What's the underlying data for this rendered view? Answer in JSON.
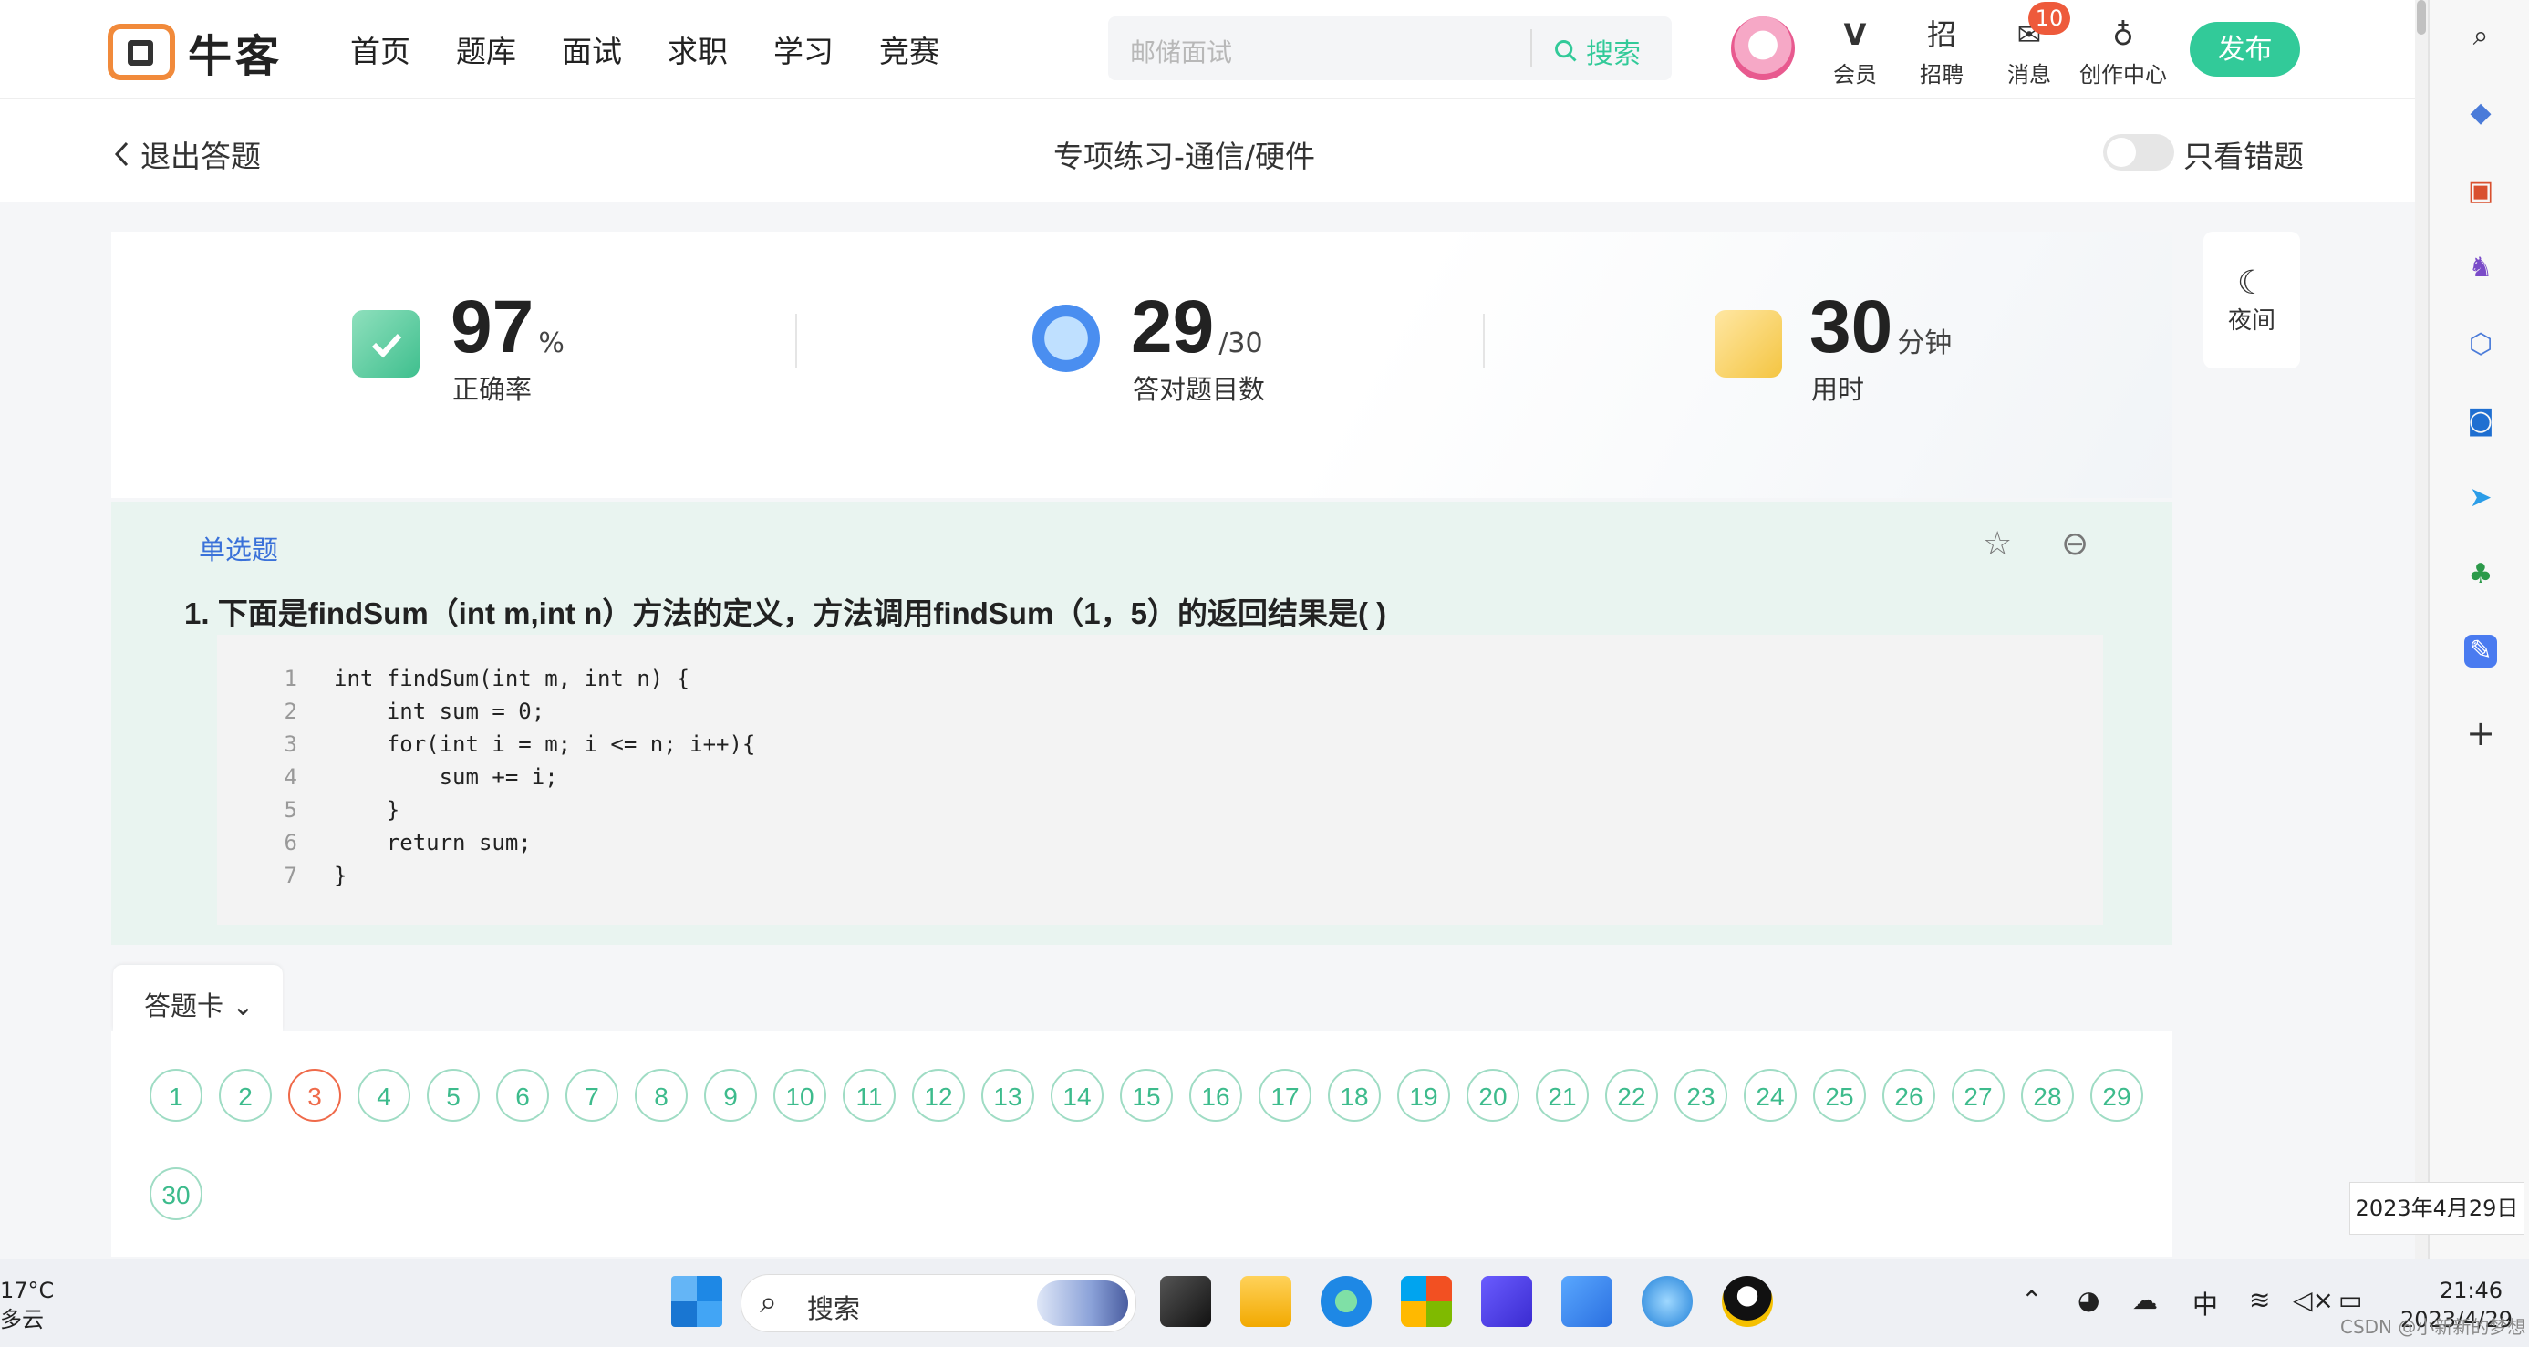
{
  "header": {
    "logo_text": "牛客",
    "nav": [
      "首页",
      "题库",
      "面试",
      "求职",
      "学习",
      "竞赛"
    ],
    "search_placeholder": "邮储面试",
    "search_button": "搜索",
    "icons": [
      {
        "label": "会员",
        "icon": "vip-icon",
        "glyph": "V"
      },
      {
        "label": "招聘",
        "icon": "recruit-icon",
        "glyph": "招"
      },
      {
        "label": "消息",
        "icon": "message-icon",
        "glyph": "✉"
      },
      {
        "label": "创作中心",
        "icon": "bulb-icon",
        "glyph": "♁"
      }
    ],
    "message_badge": "10",
    "publish_button": "发布"
  },
  "subheader": {
    "exit_label": "退出答题",
    "title": "专项练习-通信/硬件",
    "only_wrong_label": "只看错题"
  },
  "stats": {
    "accuracy": {
      "value": "97",
      "unit": "%",
      "label": "正确率"
    },
    "correct": {
      "value": "29",
      "unit": "/30",
      "label": "答对题目数"
    },
    "time": {
      "value": "30",
      "unit": "分钟",
      "label": "用时"
    },
    "night_label": "夜间"
  },
  "question": {
    "type": "单选题",
    "number": "1.",
    "text": "下面是findSum（int m,int n）方法的定义，方法调用findSum（1，5）的返回结果是( )",
    "code_lines": [
      {
        "n": "1",
        "code": "int findSum(int m, int n) {"
      },
      {
        "n": "2",
        "code": "    int sum = 0;"
      },
      {
        "n": "3",
        "code": "    for(int i = m; i <= n; i++){"
      },
      {
        "n": "4",
        "code": "        sum += i;"
      },
      {
        "n": "5",
        "code": "    }"
      },
      {
        "n": "6",
        "code": "    return sum;"
      },
      {
        "n": "7",
        "code": "}"
      }
    ]
  },
  "answer_card": {
    "tab_label": "答题卡",
    "numbers": [
      "1",
      "2",
      "3",
      "4",
      "5",
      "6",
      "7",
      "8",
      "9",
      "10",
      "11",
      "12",
      "13",
      "14",
      "15",
      "16",
      "17",
      "18",
      "19",
      "20",
      "21",
      "22",
      "23",
      "24",
      "25",
      "26",
      "27",
      "28",
      "29",
      "30"
    ],
    "wrong": [
      "3"
    ]
  },
  "date_tooltip": "2023年4月29日",
  "taskbar": {
    "weather_temp": "17°C",
    "weather_desc": "多云",
    "search_label": "搜索",
    "ime": "中",
    "time": "21:46",
    "date": "2023/4/29",
    "watermark": "CSDN @小新新的梦想"
  },
  "colors": {
    "accent": "#32ca99",
    "wrong": "#ef6a4a",
    "link": "#3a71d9",
    "question_bg": "#e9f4f0"
  }
}
